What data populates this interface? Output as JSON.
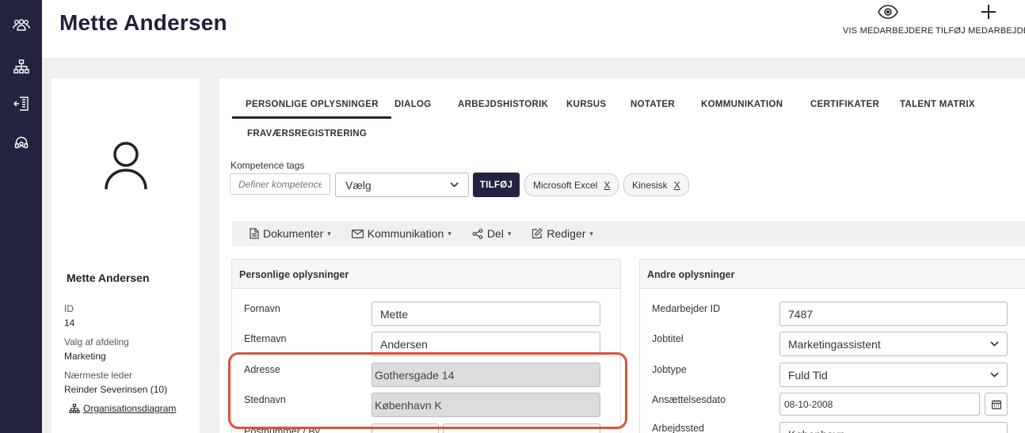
{
  "page": {
    "title": "Mette Andersen"
  },
  "header_actions": {
    "view_employees": "VIS MEDARBEJDERE",
    "add_employee": "TILFØJ MEDARBEJDERE"
  },
  "rail": {
    "icons": [
      "people-icon",
      "org-chart-icon",
      "exit-building-icon",
      "support-headset-icon"
    ]
  },
  "profile": {
    "name": "Mette Andersen",
    "id_label": "ID",
    "id_value": "14",
    "department_label": "Valg af afdeling",
    "department_value": "Marketing",
    "manager_label": "Nærmeste leder",
    "manager_value": "Reinder Severinsen (10)",
    "org_link": "Organisationsdiagram"
  },
  "tabs": [
    {
      "label": "PERSONLIGE OPLYSNINGER",
      "active": true
    },
    {
      "label": "DIALOG"
    },
    {
      "label": "ARBEJDSHISTORIK"
    },
    {
      "label": "KURSUS"
    },
    {
      "label": "NOTATER"
    },
    {
      "label": "KOMMUNIKATION"
    },
    {
      "label": "CERTIFIKATER"
    },
    {
      "label": "TALENT MATRIX"
    },
    {
      "label": "FRAVÆRSREGISTRERING"
    }
  ],
  "tags": {
    "label": "Kompetence tags",
    "input_placeholder": "Definer kompetencetag",
    "select_value": "Vælg",
    "add_button": "TILFØJ",
    "chips": [
      {
        "label": "Microsoft Excel",
        "remove": "X"
      },
      {
        "label": "Kinesisk",
        "remove": "X"
      }
    ]
  },
  "toolbar": {
    "documents": "Dokumenter",
    "communication": "Kommunikation",
    "share": "Del",
    "edit": "Rediger"
  },
  "personal": {
    "title": "Personlige oplysninger",
    "first_name_label": "Fornavn",
    "first_name": "Mette",
    "last_name_label": "Efternavn",
    "last_name": "Andersen",
    "address_label": "Adresse",
    "address": "Gothersgade 14",
    "city_label": "Stednavn",
    "city": "København K",
    "postal_label": "Postnummer / By"
  },
  "other": {
    "title": "Andre oplysninger",
    "employee_id_label": "Medarbejder ID",
    "employee_id": "7487",
    "job_title_label": "Jobtitel",
    "job_title": "Marketingassistent",
    "job_type_label": "Jobtype",
    "job_type": "Fuld Tid",
    "hire_date_label": "Ansættelsesdato",
    "hire_date": "08-10-2008",
    "workplace_label": "Arbejdssted",
    "workplace": "København"
  },
  "colors": {
    "nav": "#23233f",
    "highlight": "#d9533b",
    "disabled_field": "#dcdcdc"
  }
}
